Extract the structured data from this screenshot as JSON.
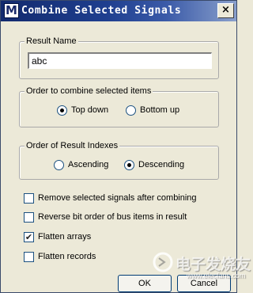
{
  "window": {
    "title": "Combine Selected Signals",
    "app_icon_glyph": "M",
    "close_glyph": "×"
  },
  "result_name": {
    "legend": "Result Name",
    "value": "abc"
  },
  "order_group": {
    "legend": "Order to combine selected items",
    "options": [
      {
        "label": "Top down",
        "selected": true
      },
      {
        "label": "Bottom up",
        "selected": false
      }
    ]
  },
  "index_group": {
    "legend": "Order of Result Indexes",
    "options": [
      {
        "label": "Ascending",
        "selected": false
      },
      {
        "label": "Descending",
        "selected": true
      }
    ]
  },
  "options": [
    {
      "label": "Remove selected signals after combining",
      "checked": false
    },
    {
      "label": "Reverse bit order of bus items in result",
      "checked": false
    },
    {
      "label": "Flatten arrays",
      "checked": true
    },
    {
      "label": "Flatten records",
      "checked": false
    }
  ],
  "buttons": {
    "ok": "OK",
    "cancel": "Cancel"
  },
  "watermark": {
    "text": "电子发烧友",
    "url": "www.elecfans.com"
  }
}
